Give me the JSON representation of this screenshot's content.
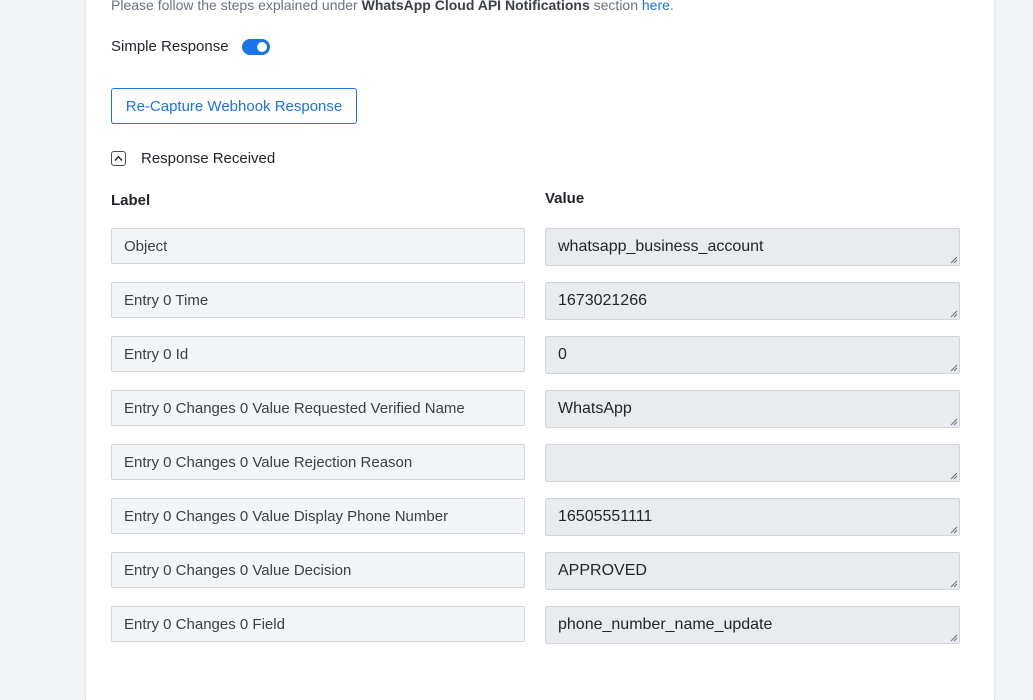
{
  "intro": {
    "text_before": "Please follow the steps explained under ",
    "bold": "WhatsApp Cloud API Notifications",
    "text_after": " section ",
    "link": "here",
    "period": "."
  },
  "simple_response": {
    "label": "Simple Response",
    "enabled": true
  },
  "recapture_button": "Re-Capture Webhook Response",
  "response_section": {
    "label": "Response Received",
    "expanded": true
  },
  "columns": {
    "label": "Label",
    "value": "Value"
  },
  "fields": [
    {
      "label": "Object",
      "value": "whatsapp_business_account"
    },
    {
      "label": "Entry 0 Time",
      "value": "1673021266"
    },
    {
      "label": "Entry 0 Id",
      "value": "0"
    },
    {
      "label": "Entry 0 Changes 0 Value Requested Verified Name",
      "value": "WhatsApp"
    },
    {
      "label": "Entry 0 Changes 0 Value Rejection Reason",
      "value": ""
    },
    {
      "label": "Entry 0 Changes 0 Value Display Phone Number",
      "value": "16505551111"
    },
    {
      "label": "Entry 0 Changes 0 Value Decision",
      "value": "APPROVED"
    },
    {
      "label": "Entry 0 Changes 0 Field",
      "value": "phone_number_name_update"
    }
  ],
  "colors": {
    "accent": "#1a73e8",
    "label_bg": "#f4f5f7",
    "value_bg": "#e9ebee",
    "page_bg": "#f3f5f9"
  }
}
